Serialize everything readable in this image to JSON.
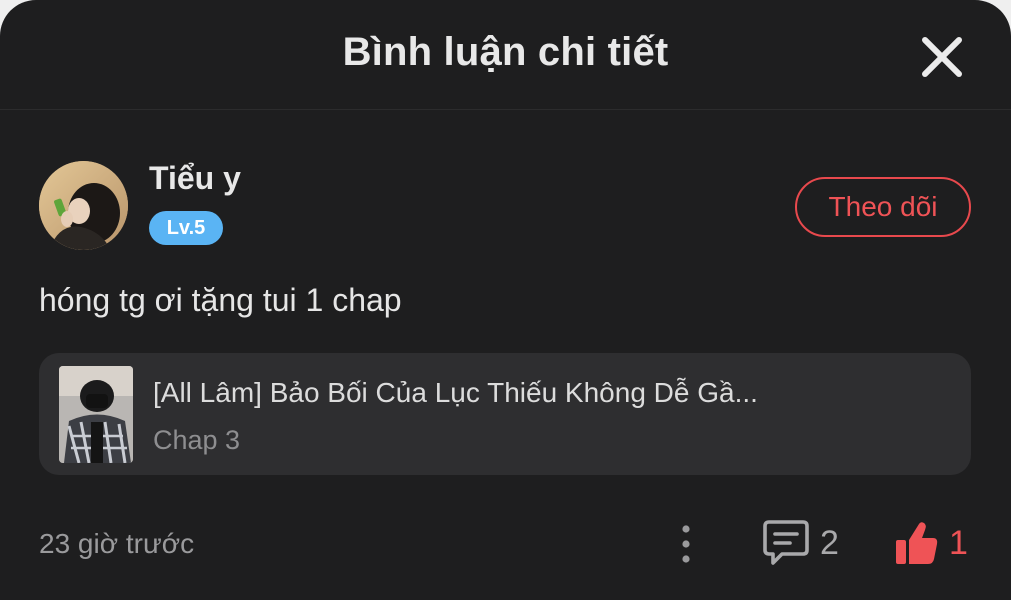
{
  "header": {
    "title": "Bình luận chi tiết",
    "close_icon": "close-icon"
  },
  "comment": {
    "user": {
      "name": "Tiểu y",
      "level": "Lv.5",
      "avatar_icon": "avatar-photo"
    },
    "follow_label": "Theo dõi",
    "text": "hóng tg ơi tặng tui 1 chap",
    "chapter": {
      "title": "[All Lâm] Bảo Bối Của Lục Thiếu Không Dễ Gầ...",
      "subtitle": "Chap 3",
      "thumb_icon": "comic-cover-thumbnail"
    },
    "timestamp": "23 giờ trước",
    "reply_count": "2",
    "like_count": "1"
  },
  "colors": {
    "background": "#1e1e1f",
    "accent_red": "#ef5356",
    "level_badge": "#5ab4f4",
    "card": "#2e2e30"
  }
}
